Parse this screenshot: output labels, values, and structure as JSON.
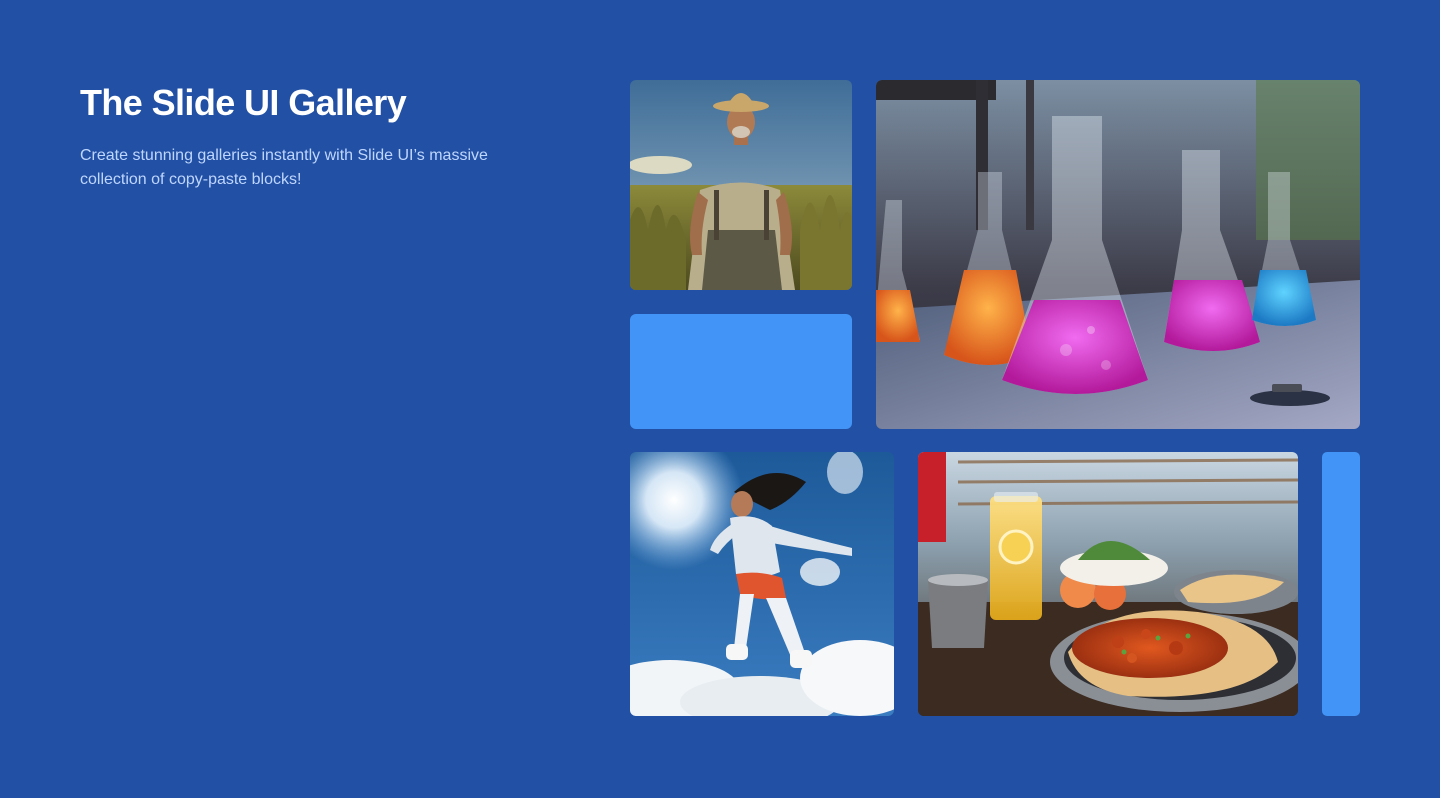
{
  "page": {
    "background": "#2150a4",
    "accent_block_color": "#4295f6"
  },
  "hero": {
    "title": "The Slide UI Gallery",
    "subtitle": "Create stunning galleries instantly with Slide UI’s massive collection of copy-paste blocks!"
  },
  "gallery": {
    "images": [
      {
        "subject": "farmer-in-cornfield"
      },
      {
        "subject": "colorful-lab-flasks"
      },
      {
        "subject": "woman-jumping-in-sky"
      },
      {
        "subject": "curry-and-naan-meal"
      }
    ],
    "placeholder_blocks": [
      {
        "color": "#4295f6"
      },
      {
        "color": "#4295f6"
      }
    ]
  }
}
